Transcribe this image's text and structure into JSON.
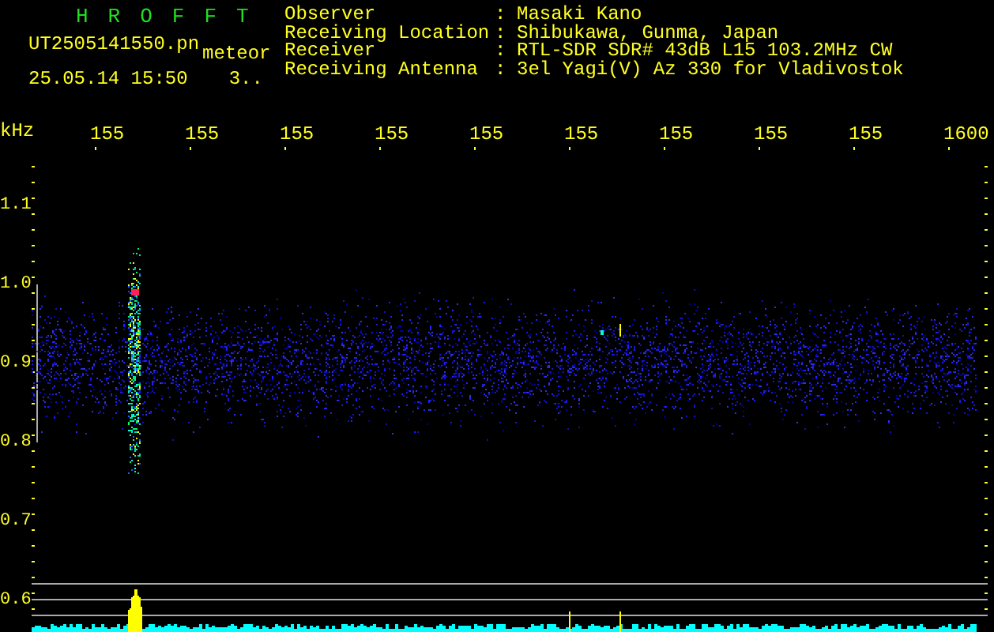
{
  "app_title": "HROFFT",
  "file": {
    "name": "UT2505141550.pn",
    "tag": "meteor",
    "datetime": "25.05.14 15:50",
    "count": "3.."
  },
  "info": [
    {
      "label": "Observer",
      "separator": ":",
      "value": "Masaki Kano"
    },
    {
      "label": "Receiving Location",
      "separator": ":",
      "value": "Shibukawa, Gunma, Japan"
    },
    {
      "label": "Receiver",
      "separator": ":",
      "value": "RTL-SDR SDR# 43dB L15 103.2MHz CW"
    },
    {
      "label": "Receiving Antenna",
      "separator": ":",
      "value": "3el Yagi(V) Az 330 for Vladivostok"
    }
  ],
  "x_axis": {
    "unit": "kHz",
    "labels": [
      "155",
      "155",
      "155",
      "155",
      "155",
      "155",
      "155",
      "155",
      "155",
      "1600"
    ]
  },
  "y_axis": {
    "labels": [
      "1.1",
      "1.0",
      "0.9",
      "0.8",
      "0.7",
      "0.6"
    ]
  }
}
